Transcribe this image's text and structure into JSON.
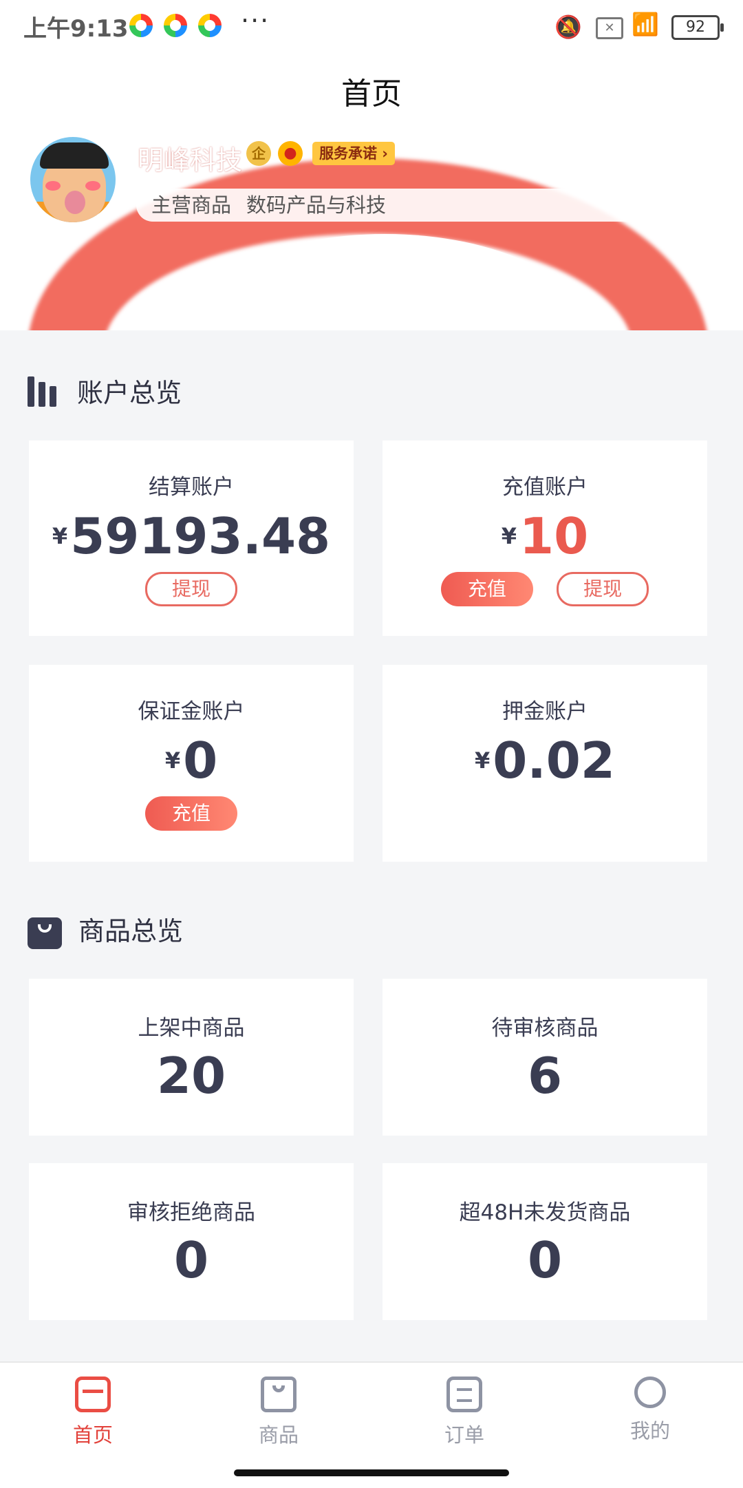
{
  "status_bar": {
    "time": "上午9:13",
    "more": "···",
    "battery": "92"
  },
  "header": {
    "title": "首页",
    "shop_name": "明峰科技",
    "badge_qi": "企",
    "service_tag": "服务承诺 ›",
    "main_goods_label": "主营商品",
    "main_goods_value": "数码产品与科技"
  },
  "account_overview": {
    "title": "账户总览",
    "currency": "¥",
    "cards": [
      {
        "label": "结算账户",
        "amount": "59193.48",
        "buttons": [
          "提现"
        ]
      },
      {
        "label": "充值账户",
        "amount": "10",
        "buttons": [
          "充值",
          "提现"
        ]
      },
      {
        "label": "保证金账户",
        "amount": "0",
        "buttons": [
          "充值"
        ]
      },
      {
        "label": "押金账户",
        "amount": "0.02",
        "buttons": []
      }
    ]
  },
  "goods_overview": {
    "title": "商品总览",
    "cards": [
      {
        "label": "上架中商品",
        "count": "20"
      },
      {
        "label": "待审核商品",
        "count": "6"
      },
      {
        "label": "审核拒绝商品",
        "count": "0"
      },
      {
        "label": "超48H未发货商品",
        "count": "0"
      }
    ]
  },
  "bottom_nav": [
    {
      "label": "首页",
      "icon": "store-icon",
      "active": true
    },
    {
      "label": "商品",
      "icon": "shopping-bag-icon",
      "active": false
    },
    {
      "label": "订单",
      "icon": "clipboard-icon",
      "active": false
    },
    {
      "label": "我的",
      "icon": "user-icon",
      "active": false
    }
  ],
  "colors": {
    "accent": "#ea5a4f",
    "text": "#3a3d52",
    "background": "#f4f5f7"
  }
}
